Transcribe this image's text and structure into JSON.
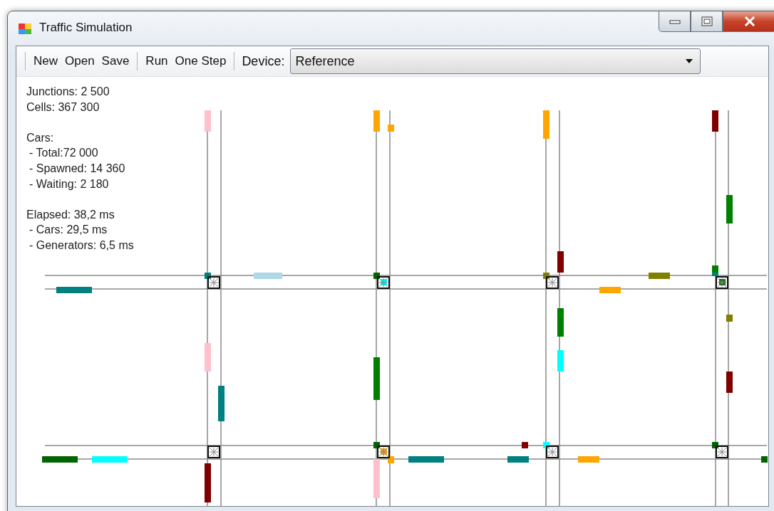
{
  "window": {
    "title": "Traffic Simulation"
  },
  "toolbar": {
    "groups": [
      [
        "New",
        "Open",
        "Save"
      ],
      [
        "Run",
        "One Step"
      ]
    ],
    "device_label": "Device:",
    "device": {
      "value": "Reference"
    }
  },
  "stats": [
    {
      "lines": [
        "Junctions: 2 500",
        "Cells: 367 300"
      ]
    },
    {
      "title": "Cars:",
      "items": [
        "- Total:72 000",
        "- Spawned: 14 360",
        "- Waiting: 2 180"
      ]
    },
    {
      "title": "Elapsed: 38,2 ms",
      "items": [
        "- Cars: 29,5 ms",
        "- Generators: 6,5 ms"
      ]
    }
  ]
}
